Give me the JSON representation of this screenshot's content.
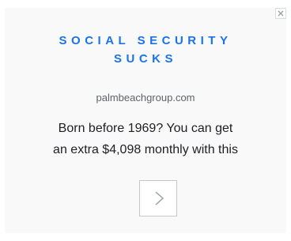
{
  "ad": {
    "headline_line1": "SOCIAL SECURITY",
    "headline_line2": "SUCKS",
    "domain": "palmbeachgroup.com",
    "description_line1": "Born before 1969? You can get",
    "description_line2": "an extra $4,098 monthly with this",
    "cta_icon": "chevron-right-icon",
    "adchoices_icon": "close-icon",
    "colors": {
      "headline": "#1a73e8",
      "background": "#f9f9f9",
      "text": "#202124",
      "domain": "#5f6368"
    }
  }
}
